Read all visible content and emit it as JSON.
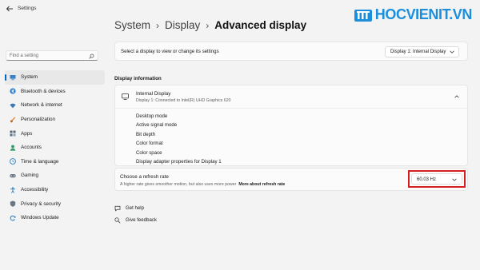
{
  "window": {
    "title": "Settings"
  },
  "watermark": {
    "text": "HOCVIENIT.VN"
  },
  "search": {
    "placeholder": "Find a setting"
  },
  "sidebar": {
    "items": [
      {
        "label": "System",
        "icon": "monitor-icon",
        "active": true
      },
      {
        "label": "Bluetooth & devices",
        "icon": "bluetooth-icon"
      },
      {
        "label": "Network & internet",
        "icon": "wifi-icon"
      },
      {
        "label": "Personalization",
        "icon": "brush-icon"
      },
      {
        "label": "Apps",
        "icon": "apps-icon"
      },
      {
        "label": "Accounts",
        "icon": "person-icon"
      },
      {
        "label": "Time & language",
        "icon": "globe-clock-icon"
      },
      {
        "label": "Gaming",
        "icon": "gamepad-icon"
      },
      {
        "label": "Accessibility",
        "icon": "accessibility-icon"
      },
      {
        "label": "Privacy & security",
        "icon": "shield-icon"
      },
      {
        "label": "Windows Update",
        "icon": "update-icon"
      }
    ]
  },
  "breadcrumb": {
    "part1": "System",
    "part2": "Display",
    "current": "Advanced display",
    "separator": "›"
  },
  "display_select": {
    "label": "Select a display to view or change its settings",
    "value": "Display 1: Internal Display"
  },
  "section_title": "Display information",
  "display_info": {
    "name": "Internal Display",
    "subtitle": "Display 1: Connected to Intel(R) UHD Graphics 620",
    "rows": [
      "Desktop mode",
      "Active signal mode",
      "Bit depth",
      "Color format",
      "Color space",
      "Display adapter properties for Display 1"
    ]
  },
  "refresh_rate": {
    "title": "Choose a refresh rate",
    "description": "A higher rate gives smoother motion, but also uses more power",
    "link": "More about refresh rate",
    "value": "60.03 Hz"
  },
  "help_links": {
    "get_help": "Get help",
    "give_feedback": "Give feedback"
  },
  "colors": {
    "accent": "#0067c0",
    "highlight_box": "#d42020",
    "brand": "#1b8fdc"
  }
}
